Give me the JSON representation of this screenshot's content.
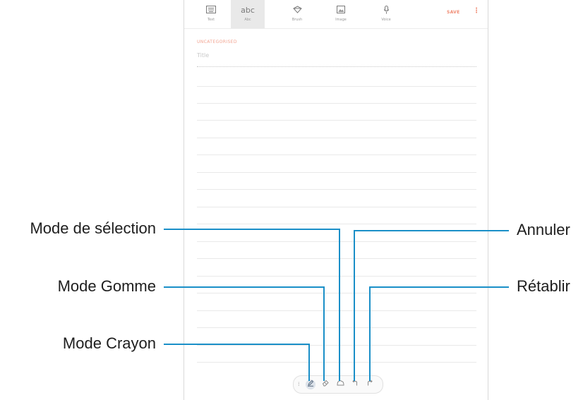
{
  "toolbar": {
    "tabs": [
      {
        "label": "Text",
        "icon": "keyboard-icon"
      },
      {
        "label": "Abc",
        "icon": "handwriting-icon",
        "glyph": "abc"
      },
      {
        "label": "Brush",
        "icon": "brush-icon"
      },
      {
        "label": "Image",
        "icon": "image-icon"
      },
      {
        "label": "Voice",
        "icon": "microphone-icon"
      }
    ],
    "save_label": "SAVE",
    "more_label": "⋮"
  },
  "note": {
    "category": "UNCATEGORISED",
    "title_placeholder": "Title"
  },
  "pen_toolbar": {
    "tools": [
      "pen-icon",
      "eraser-icon",
      "selection-icon",
      "undo-icon",
      "redo-icon"
    ]
  },
  "callouts": {
    "selection_mode": "Mode de sélection",
    "eraser_mode": "Mode Gomme",
    "pen_mode": "Mode Crayon",
    "undo": "Annuler",
    "redo": "Rétablir"
  },
  "colors": {
    "accent": "#f08a72",
    "callout_line": "#1a8fc8"
  }
}
